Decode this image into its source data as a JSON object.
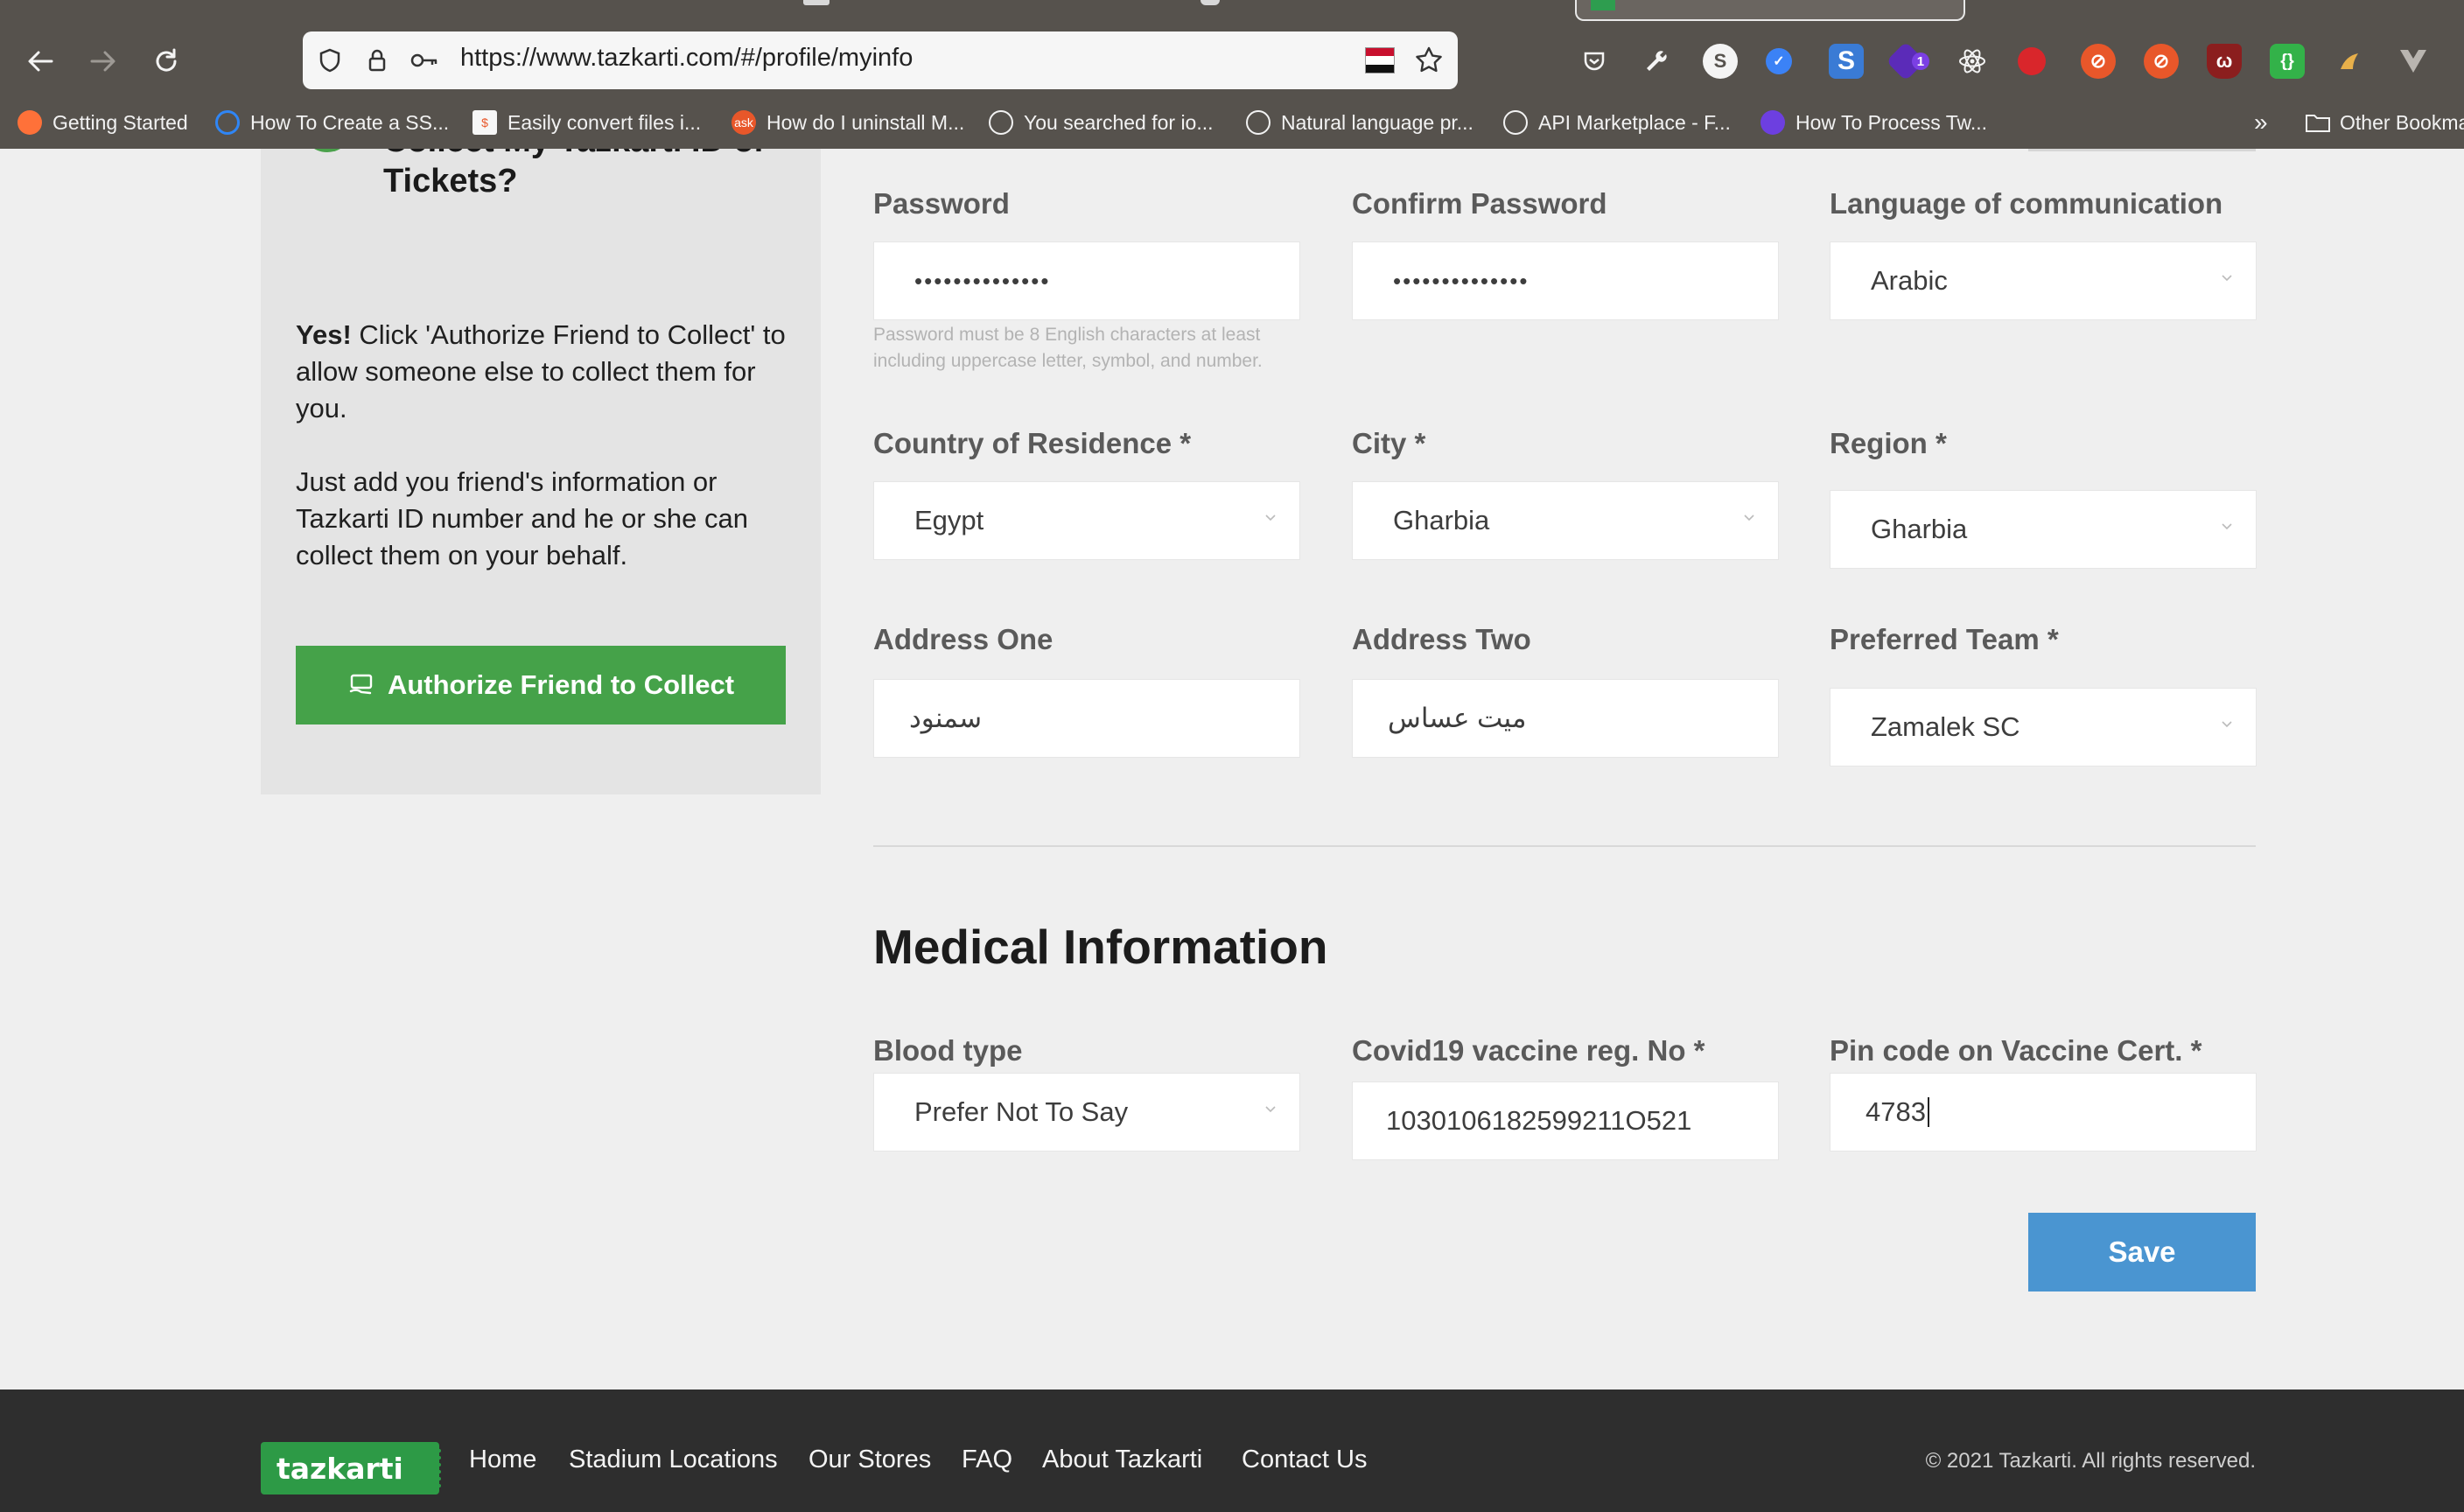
{
  "browser": {
    "url": "https://www.tazkarti.com/#/profile/myinfo",
    "bookmarks": [
      {
        "label": "Getting Started",
        "icon": "firefox-icon"
      },
      {
        "label": "How To Create a SS...",
        "icon": "loader-icon"
      },
      {
        "label": "Easily convert files i...",
        "icon": "convert-icon"
      },
      {
        "label": "How do I uninstall M...",
        "icon": "ask-icon"
      },
      {
        "label": "You searched for io...",
        "icon": "globe-icon"
      },
      {
        "label": "Natural language pr...",
        "icon": "globe-icon"
      },
      {
        "label": "API Marketplace - F...",
        "icon": "globe-icon"
      },
      {
        "label": "How To Process Tw...",
        "icon": "paw-icon"
      }
    ],
    "other_bookmarks": "Other Bookmarks",
    "ext_badge_count": "1"
  },
  "sidebar": {
    "title": "Collect My Tazkarti ID or Tickets?",
    "yes": "Yes!",
    "p1": " Click 'Authorize Friend to Collect' to allow someone else to collect them for you.",
    "p2": "Just add you friend's information or Tazkarti ID number and he or she can collect them on your behalf.",
    "button": "Authorize Friend to Collect"
  },
  "form": {
    "password_label": "Password",
    "password_value": "••••••••••••••",
    "confirm_label": "Confirm Password",
    "confirm_value": "••••••••••••••",
    "language_label": "Language of communication",
    "language_value": "Arabic",
    "password_hint": "Password must be 8 English characters at least including uppercase letter, symbol, and number.",
    "country_label": "Country of Residence *",
    "country_value": "Egypt",
    "city_label": "City *",
    "city_value": "Gharbia",
    "region_label": "Region *",
    "region_value": "Gharbia",
    "address1_label": "Address One",
    "address1_value": "سمنود",
    "address2_label": "Address Two",
    "address2_value": "ميت عساس",
    "team_label": "Preferred Team *",
    "team_value": "Zamalek SC"
  },
  "medical": {
    "title": "Medical Information",
    "blood_label": "Blood type",
    "blood_value": "Prefer Not To Say",
    "covid_label": "Covid19 vaccine reg. No *",
    "covid_value": "1030106182599211O521",
    "pin_label": "Pin code on Vaccine Cert. *",
    "pin_value": "4783",
    "save": "Save"
  },
  "footer": {
    "logo": "tazkarti",
    "links": [
      "Home",
      "Stadium Locations",
      "Our Stores",
      "FAQ",
      "About Tazkarti",
      "Contact Us"
    ],
    "copyright": "© 2021 Tazkarti. All rights reserved."
  }
}
